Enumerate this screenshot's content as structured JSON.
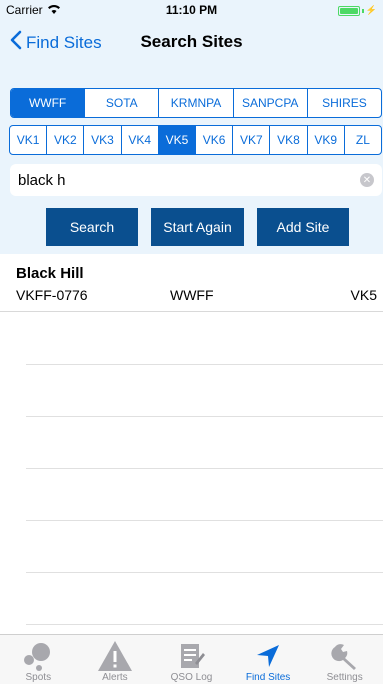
{
  "status": {
    "carrier": "Carrier",
    "time": "11:10 PM"
  },
  "nav": {
    "back_label": "Find Sites",
    "title": "Search Sites"
  },
  "programs": [
    {
      "label": "WWFF",
      "active": true
    },
    {
      "label": "SOTA",
      "active": false
    },
    {
      "label": "KRMNPA",
      "active": false
    },
    {
      "label": "SANPCPA",
      "active": false
    },
    {
      "label": "SHIRES",
      "active": false
    }
  ],
  "regions": [
    {
      "label": "VK1",
      "active": false
    },
    {
      "label": "VK2",
      "active": false
    },
    {
      "label": "VK3",
      "active": false
    },
    {
      "label": "VK4",
      "active": false
    },
    {
      "label": "VK5",
      "active": true
    },
    {
      "label": "VK6",
      "active": false
    },
    {
      "label": "VK7",
      "active": false
    },
    {
      "label": "VK8",
      "active": false
    },
    {
      "label": "VK9",
      "active": false
    },
    {
      "label": "ZL",
      "active": false
    }
  ],
  "search": {
    "value": "black h",
    "placeholder": ""
  },
  "buttons": {
    "search": "Search",
    "start_again": "Start Again",
    "add_site": "Add Site"
  },
  "results": [
    {
      "name": "Black Hill",
      "reference": "VKFF-0776",
      "program": "WWFF",
      "region": "VK5"
    }
  ],
  "tabs": [
    {
      "label": "Spots",
      "icon": "spots-icon",
      "active": false
    },
    {
      "label": "Alerts",
      "icon": "alert-icon",
      "active": false
    },
    {
      "label": "QSO Log",
      "icon": "log-icon",
      "active": false
    },
    {
      "label": "Find Sites",
      "icon": "location-arrow-icon",
      "active": true
    },
    {
      "label": "Settings",
      "icon": "wrench-icon",
      "active": false
    }
  ],
  "colors": {
    "accent": "#0a6cd9",
    "button": "#0a4f8f",
    "header_bg": "#eaf4fc"
  }
}
